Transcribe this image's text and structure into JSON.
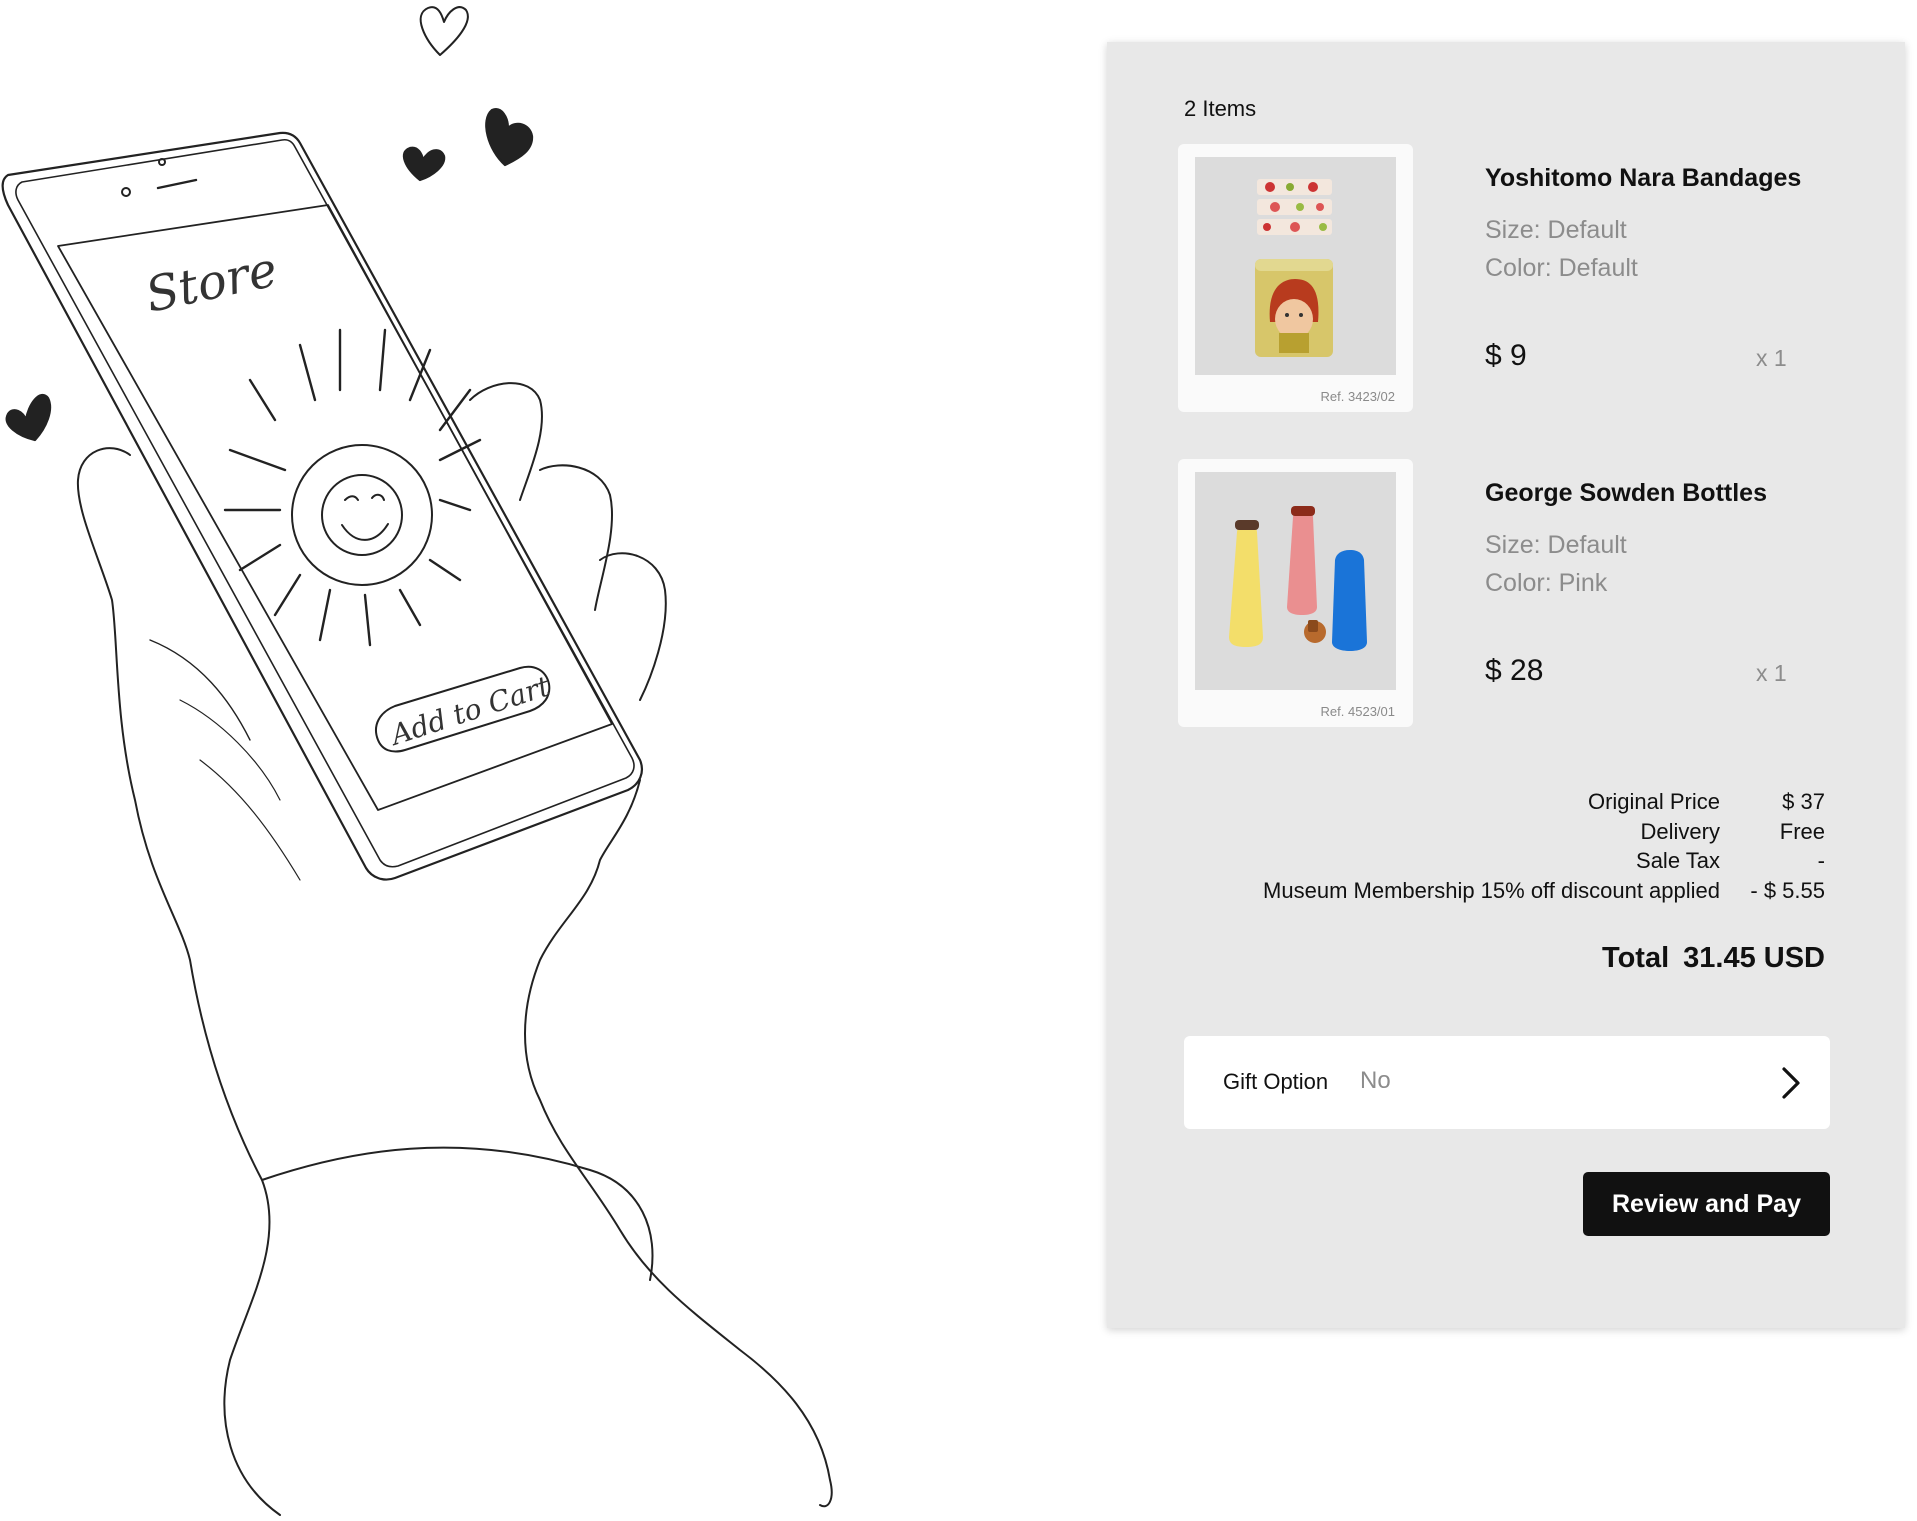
{
  "sketch": {
    "screen_title": "Store",
    "add_to_cart_label": "Add to Cart"
  },
  "cart": {
    "items_count": "2 Items",
    "items": [
      {
        "name": "Yoshitomo Nara Bandages",
        "size": "Size: Default",
        "color": "Color: Default",
        "price": "$ 9",
        "qty": "x 1",
        "ref": "Ref. 3423/02"
      },
      {
        "name": "George Sowden Bottles",
        "size": "Size: Default",
        "color": "Color: Pink",
        "price": "$ 28",
        "qty": "x 1",
        "ref": "Ref. 4523/01"
      }
    ],
    "summary": [
      {
        "label": "Original Price",
        "value": "$ 37"
      },
      {
        "label": "Delivery",
        "value": "Free"
      },
      {
        "label": "Sale Tax",
        "value": "-"
      },
      {
        "label": "Museum Membership 15% off discount applied",
        "value": "- $ 5.55"
      }
    ],
    "total_label": "Total",
    "total_value": "31.45 USD",
    "gift_option_label": "Gift Option",
    "gift_option_value": "No",
    "pay_button_label": "Review and Pay"
  },
  "colors": {
    "panel_bg": "#e8e8e8",
    "button_bg": "#111111",
    "muted_text": "#8c8c8c"
  }
}
